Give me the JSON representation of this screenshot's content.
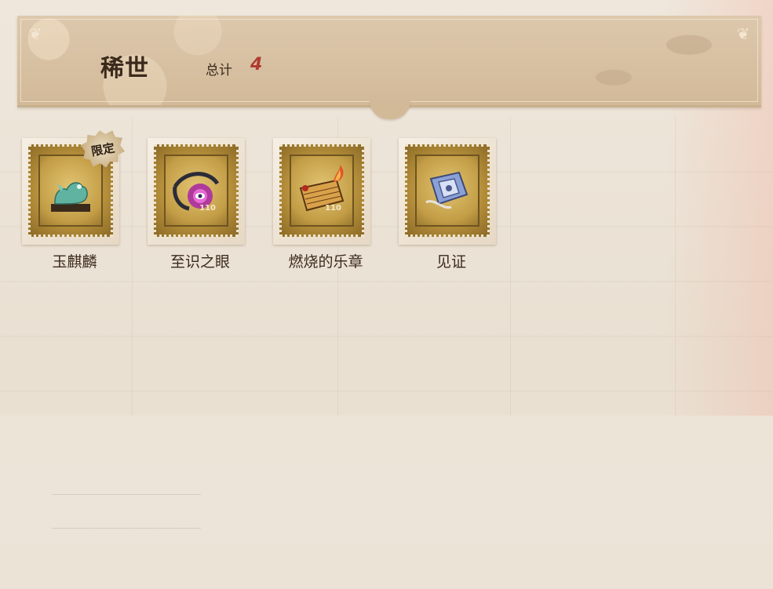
{
  "header": {
    "title": "稀世",
    "total_label": "总计",
    "total_value": "4"
  },
  "items": [
    {
      "name": "玉麒麟",
      "icon": "jade-qilin-icon",
      "badge": "限定",
      "value_mark": ""
    },
    {
      "name": "至识之眼",
      "icon": "eye-of-knowledge-icon",
      "badge": "",
      "value_mark": "110"
    },
    {
      "name": "燃烧的乐章",
      "icon": "burning-score-icon",
      "badge": "",
      "value_mark": "110"
    },
    {
      "name": "见证",
      "icon": "witness-icon",
      "badge": "",
      "value_mark": ""
    }
  ],
  "colors": {
    "title_text": "#3b2a1c",
    "total_value": "#b03c32",
    "stamp_gold": "#c39d46",
    "banner_bg": "#d7c0a2"
  }
}
